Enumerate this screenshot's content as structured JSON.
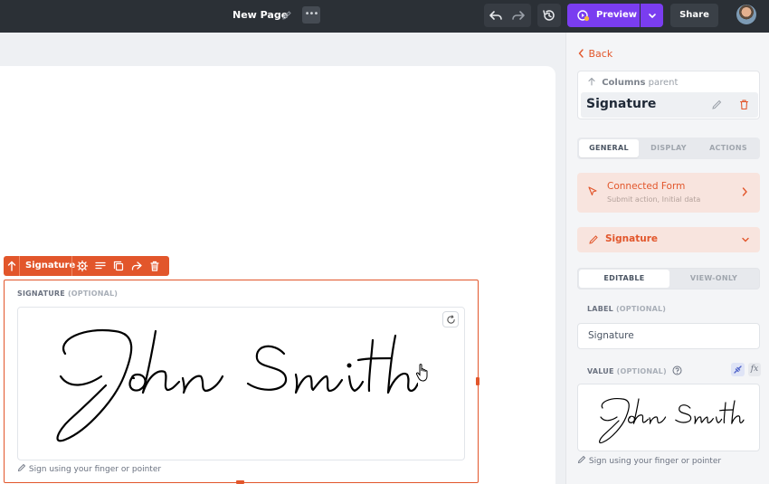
{
  "app": {
    "page_title": "New Page",
    "more_label": "•••",
    "preview_label": "Preview",
    "share_label": "Share"
  },
  "canvas": {
    "toolbar_label": "Signature",
    "field_label": "SIGNATURE",
    "field_optional": "(OPTIONAL)",
    "hint": "Sign using your finger or pointer"
  },
  "panel": {
    "back_label": "Back",
    "parent_prefix": "Columns",
    "parent_suffix": "parent",
    "component_name": "Signature",
    "tabs": [
      "GENERAL",
      "DISPLAY",
      "ACTIONS"
    ],
    "active_tab": "GENERAL",
    "connected_form_title": "Connected Form",
    "connected_form_sub": "Submit action, Initial data",
    "section_title": "Signature",
    "modes": [
      "EDITABLE",
      "VIEW-ONLY"
    ],
    "active_mode": "EDITABLE",
    "label_title": "LABEL",
    "label_optional": "(OPTIONAL)",
    "label_value": "Signature",
    "value_title": "VALUE",
    "value_optional": "(OPTIONAL)",
    "fx_label": "fx",
    "hint": "Sign using your finger or pointer"
  },
  "colors": {
    "accent": "#e2562b",
    "brand_purple": "#7a3df0",
    "topbar": "#2b3036"
  },
  "icons": [
    "pencil-icon",
    "undo-icon",
    "redo-icon",
    "history-icon",
    "preview-icon",
    "chevron-down-icon",
    "arrow-up-icon",
    "gear-icon",
    "align-icon",
    "duplicate-icon",
    "share-arrow-icon",
    "trash-icon",
    "refresh-icon",
    "hand-cursor-icon",
    "chevron-left-icon",
    "cursor-icon",
    "chevron-right-icon",
    "help-icon",
    "bind-icon"
  ]
}
